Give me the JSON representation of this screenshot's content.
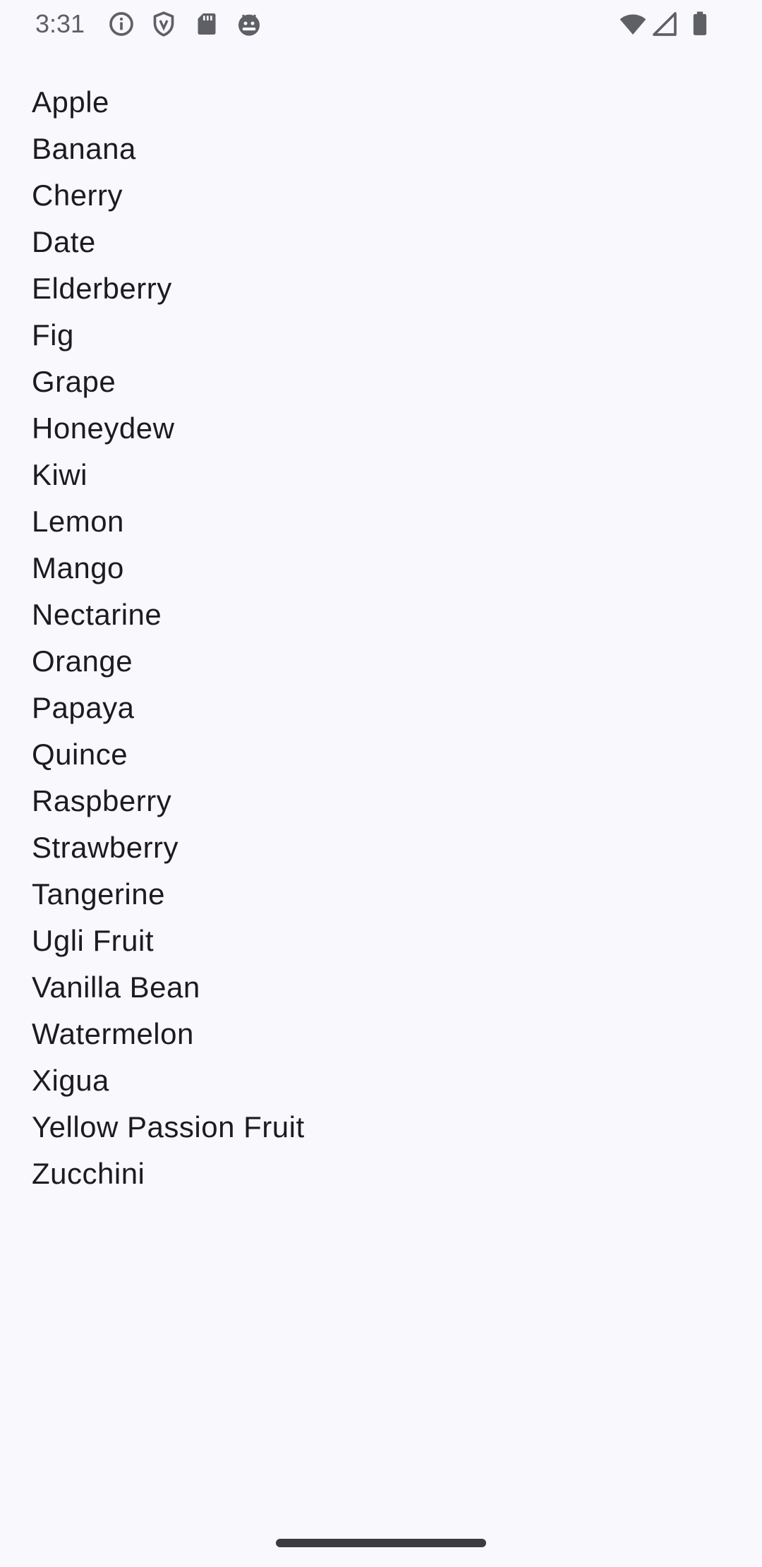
{
  "status_bar": {
    "time": "3:31",
    "left_icons": [
      "info-icon",
      "shield-icon",
      "sd-card-icon",
      "android-debug-icon"
    ],
    "right_icons": [
      "wifi-icon",
      "cellular-signal-icon",
      "battery-icon"
    ]
  },
  "fruits": [
    "Apple",
    "Banana",
    "Cherry",
    "Date",
    "Elderberry",
    "Fig",
    "Grape",
    "Honeydew",
    "Kiwi",
    "Lemon",
    "Mango",
    "Nectarine",
    "Orange",
    "Papaya",
    "Quince",
    "Raspberry",
    "Strawberry",
    "Tangerine",
    "Ugli Fruit",
    "Vanilla Bean",
    "Watermelon",
    "Xigua",
    "Yellow Passion Fruit",
    "Zucchini"
  ],
  "colors": {
    "background": "#f8f8fd",
    "text": "#1c1b1f",
    "status_icons": "#5f5f66"
  }
}
